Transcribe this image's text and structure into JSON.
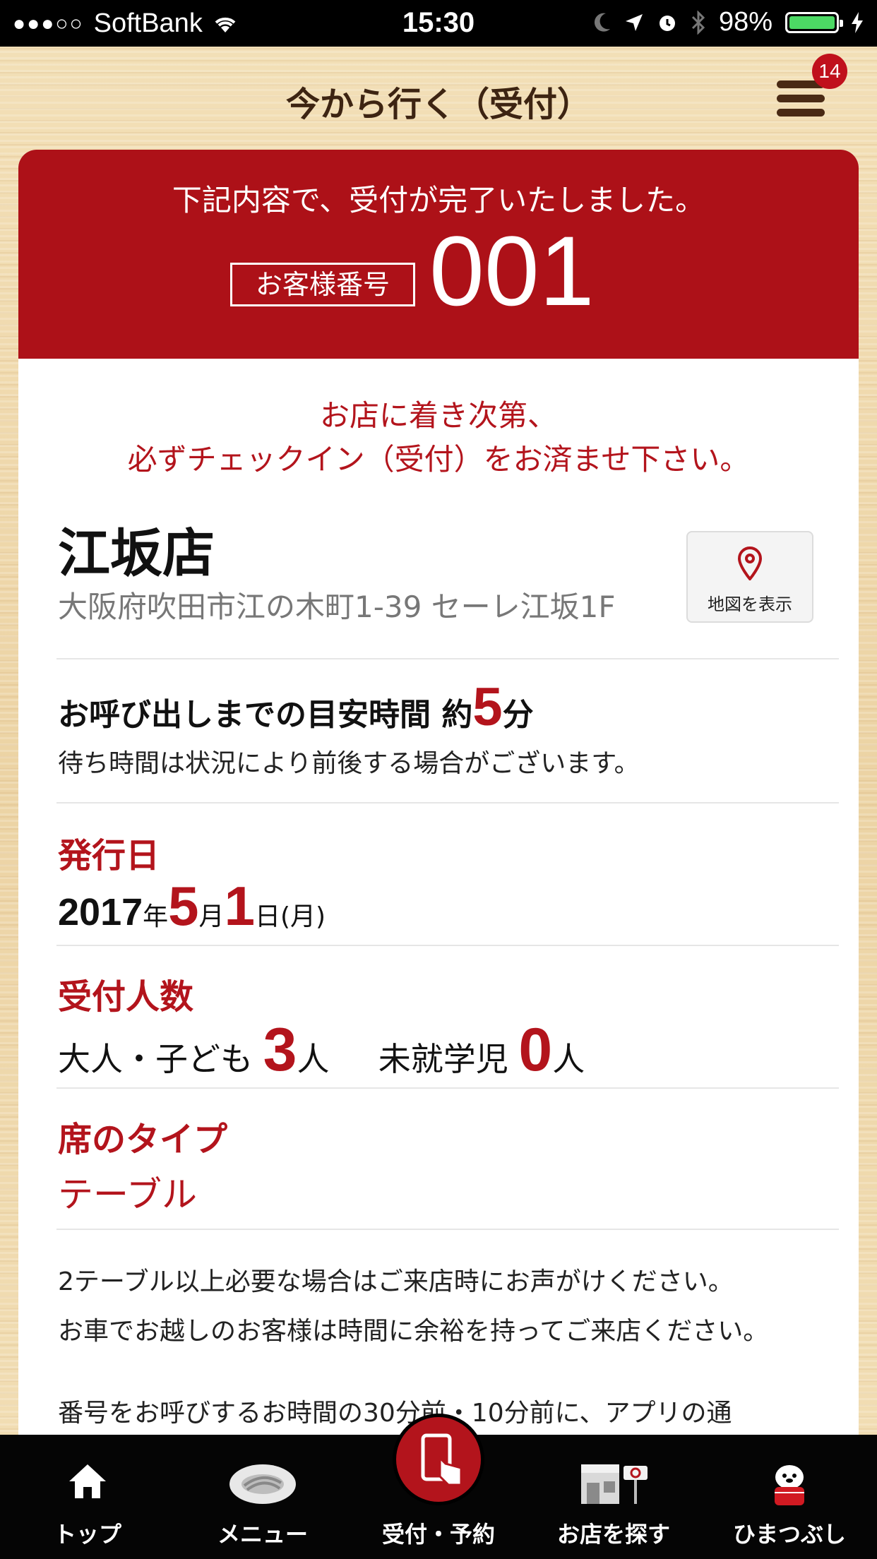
{
  "status_bar": {
    "signal": "●●●○○",
    "carrier": "SoftBank",
    "time": "15:30",
    "battery": "98%"
  },
  "nav": {
    "title": "今から行く（受付）",
    "menu_badge": "14"
  },
  "receipt": {
    "complete_message": "下記内容で、受付が完了いたしました。",
    "customer_label": "お客様番号",
    "customer_number": "001"
  },
  "notice": {
    "line1": "お店に着き次第、",
    "line2": "必ずチェックイン（受付）をお済ませ下さい。"
  },
  "store": {
    "name": "江坂店",
    "address": "大阪府吹田市江の木町1-39 セーレ江坂1F",
    "map_button": "地図を表示"
  },
  "wait": {
    "label": "お呼び出しまでの目安時間 約",
    "minutes": "5",
    "unit": "分",
    "note": "待ち時間は状況により前後する場合がございます。"
  },
  "issue_date": {
    "title": "発行日",
    "year": "2017",
    "year_unit": "年",
    "month": "5",
    "month_unit": "月",
    "day": "1",
    "day_unit": "日",
    "weekday": "(月)"
  },
  "party": {
    "title": "受付人数",
    "adults_label": "大人・子ども",
    "adults": "3",
    "unit": "人",
    "preschool_label": "未就学児",
    "preschool": "0"
  },
  "seat": {
    "title": "席のタイプ",
    "type": "テーブル"
  },
  "info": [
    "2テーブル以上必要な場合はご来店時にお声がけください。",
    "お車でお越しのお客様は時間に余裕を持ってご来店ください。",
    "番号をお呼びするお時間の30分前・10分前に、アプリの通"
  ],
  "tabs": [
    {
      "label": "トップ",
      "icon": "home-icon"
    },
    {
      "label": "メニュー",
      "icon": "sushi-plate-icon"
    },
    {
      "label": "受付・予約",
      "icon": "phone-tap-icon"
    },
    {
      "label": "お店を探す",
      "icon": "store-icon"
    },
    {
      "label": "ひまつぶし",
      "icon": "mascot-icon"
    }
  ],
  "colors": {
    "accent": "#ad1118",
    "text_red": "#b3141c",
    "tabbar": "#050505"
  }
}
